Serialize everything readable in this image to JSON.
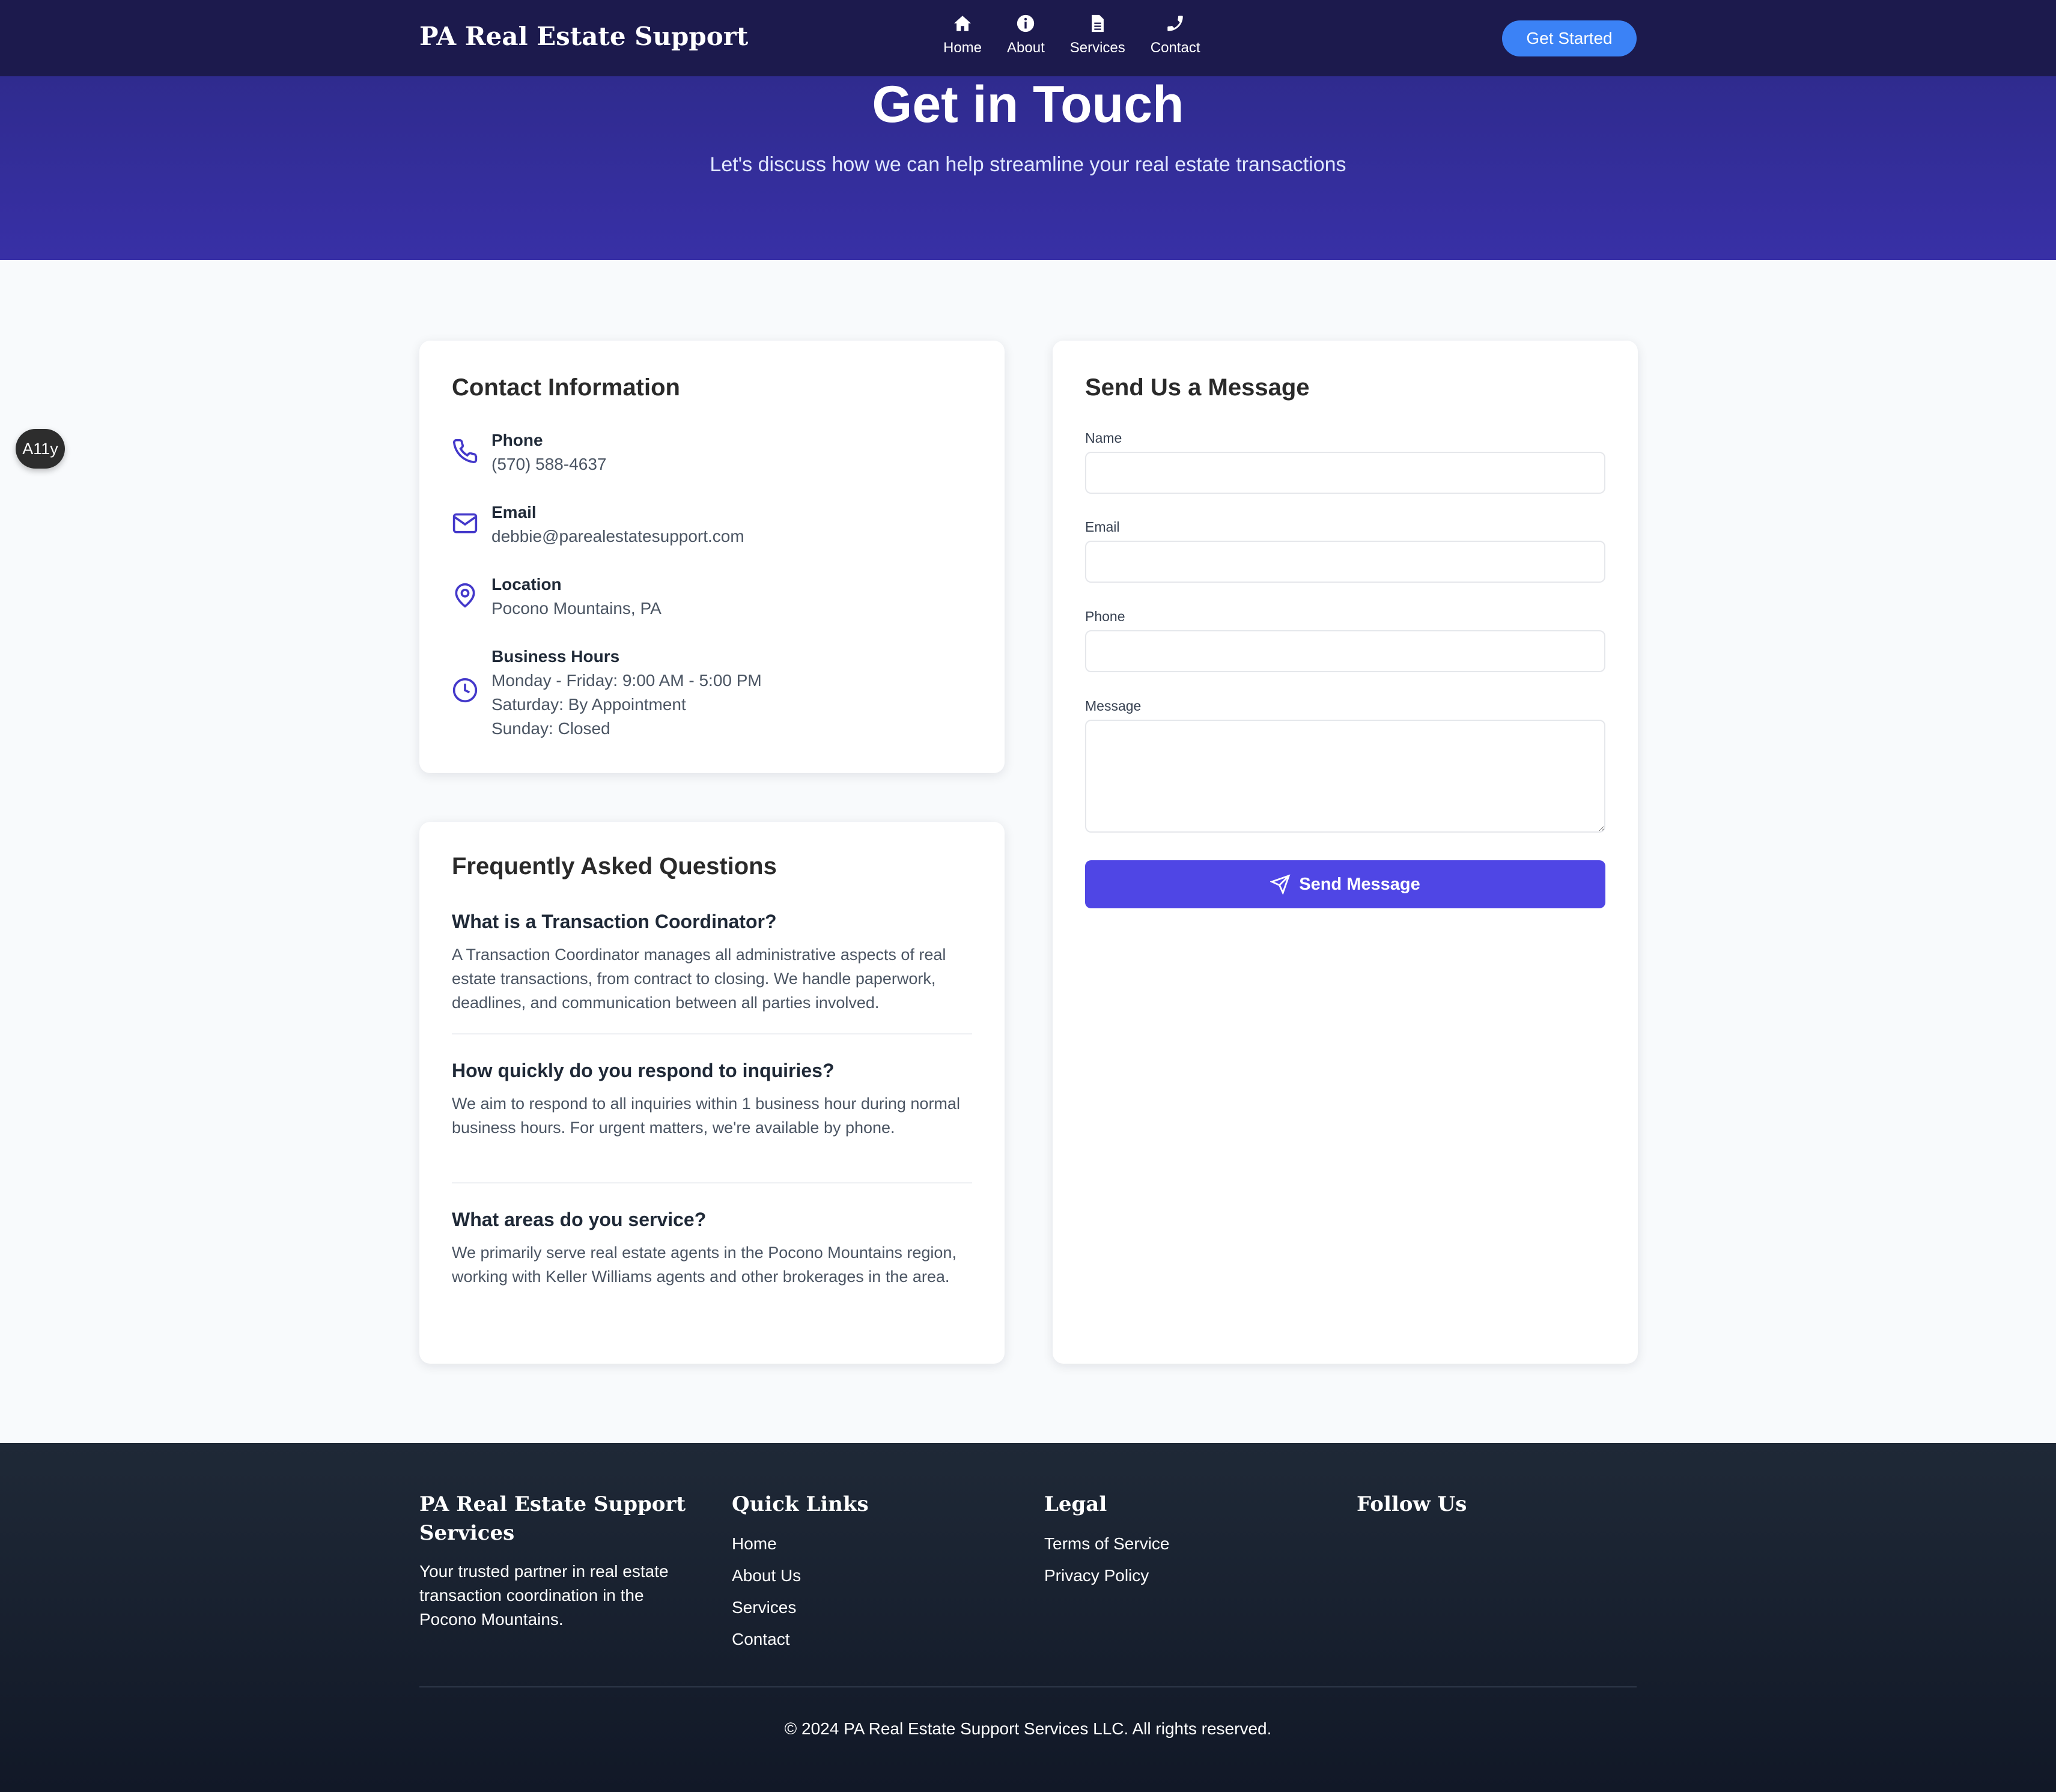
{
  "header": {
    "brand": "PA Real Estate Support",
    "nav": [
      {
        "label": "Home",
        "icon": "home-icon"
      },
      {
        "label": "About",
        "icon": "info-icon"
      },
      {
        "label": "Services",
        "icon": "document-icon"
      },
      {
        "label": "Contact",
        "icon": "phone-icon"
      }
    ],
    "cta": "Get Started"
  },
  "hero": {
    "title": "Get in Touch",
    "subtitle": "Let's discuss how we can help streamline your real estate transactions"
  },
  "a11y": {
    "label": "A11y"
  },
  "contact": {
    "title": "Contact Information",
    "items": [
      {
        "label": "Phone",
        "values": [
          "(570) 588-4637"
        ],
        "icon": "phone-icon"
      },
      {
        "label": "Email",
        "values": [
          "debbie@parealestatesupport.com"
        ],
        "icon": "mail-icon"
      },
      {
        "label": "Location",
        "values": [
          "Pocono Mountains, PA"
        ],
        "icon": "map-pin-icon"
      },
      {
        "label": "Business Hours",
        "values": [
          "Monday - Friday: 9:00 AM - 5:00 PM",
          "Saturday: By Appointment",
          "Sunday: Closed"
        ],
        "icon": "clock-icon"
      }
    ]
  },
  "faq": {
    "title": "Frequently Asked Questions",
    "items": [
      {
        "q": "What is a Transaction Coordinator?",
        "a": "A Transaction Coordinator manages all administrative aspects of real estate transactions, from contract to closing. We handle paperwork, deadlines, and communication between all parties involved."
      },
      {
        "q": "How quickly do you respond to inquiries?",
        "a": "We aim to respond to all inquiries within 1 business hour during normal business hours. For urgent matters, we're available by phone."
      },
      {
        "q": "What areas do you service?",
        "a": "We primarily serve real estate agents in the Pocono Mountains region, working with Keller Williams agents and other brokerages in the area."
      }
    ]
  },
  "form": {
    "title": "Send Us a Message",
    "fields": {
      "name": {
        "label": "Name",
        "value": ""
      },
      "email": {
        "label": "Email",
        "value": ""
      },
      "phone": {
        "label": "Phone",
        "value": ""
      },
      "message": {
        "label": "Message",
        "value": ""
      }
    },
    "submit": "Send Message"
  },
  "footer": {
    "about_title": "PA Real Estate Support Services",
    "about_text": "Your trusted partner in real estate transaction coordination in the Pocono Mountains.",
    "quick_links_title": "Quick Links",
    "quick_links": [
      "Home",
      "About Us",
      "Services",
      "Contact"
    ],
    "legal_title": "Legal",
    "legal_links": [
      "Terms of Service",
      "Privacy Policy"
    ],
    "follow_title": "Follow Us",
    "copyright": "© 2024 PA Real Estate Support Services LLC. All rights reserved."
  },
  "colors": {
    "header_bg": "#1c1a4d",
    "hero_bg": "#3830a6",
    "accent": "#4f46e5",
    "cta": "#3b82f6",
    "footer_bg": "#1f2937"
  }
}
